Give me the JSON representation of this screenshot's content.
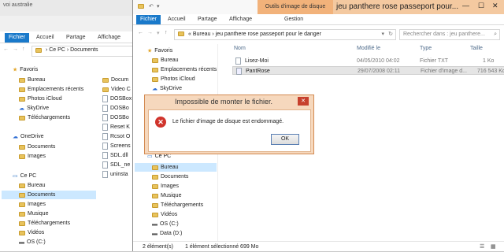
{
  "back_window": {
    "title": "voi australie",
    "tabs": [
      "Fichier",
      "Accueil",
      "Partage",
      "Affichage"
    ],
    "address": [
      "Ce PC",
      "Documents"
    ],
    "nav": {
      "favorites": "Favoris",
      "fav_items": [
        "Bureau",
        "Emplacements récents",
        "Photos iCloud",
        "SkyDrive",
        "Téléchargements"
      ],
      "onedrive": "OneDrive",
      "onedrive_items": [
        "Documents",
        "Images"
      ],
      "cepc": "Ce PC",
      "cepc_items": [
        "Bureau",
        "Documents",
        "Images",
        "Musique",
        "Téléchargements",
        "Vidéos",
        "OS (C:)"
      ]
    },
    "files": [
      "Docum",
      "Video C",
      "DOSBox",
      "DOSBo",
      "DOSBo",
      "Reset K",
      "Rcsot O",
      "Screens",
      "SDL.dll",
      "SDL_ne",
      "uninsta"
    ]
  },
  "front_window": {
    "tool_tab": "Outils d'image de disque",
    "title": "jeu panthere rose passeport pour...",
    "tabs": [
      "Fichier",
      "Accueil",
      "Partage",
      "Affichage"
    ],
    "gestion": "Gestion",
    "address": [
      "Bureau",
      "jeu panthere rose passeport pour le danger"
    ],
    "search_placeholder": "Rechercher dans : jeu panthere...",
    "columns": {
      "name": "Nom",
      "modified": "Modifié le",
      "type": "Type",
      "size": "Taille"
    },
    "files": [
      {
        "name": "Lisez-Moi",
        "modified": "04/05/2010 04:02",
        "type": "Fichier TXT",
        "size": "1 Ko"
      },
      {
        "name": "PantRose",
        "modified": "29/07/2008 02:11",
        "type": "Fichier d'image d...",
        "size": "716 543 Ko"
      }
    ],
    "nav": {
      "favorites": "Favoris",
      "fav_items": [
        "Bureau",
        "Emplacements récents",
        "Photos iCloud",
        "SkyDrive"
      ],
      "cepc": "Ce PC",
      "cepc_items": [
        "Bureau",
        "Documents",
        "Images",
        "Musique",
        "Téléchargements",
        "Vidéos",
        "OS (C:)",
        "Data (D:)"
      ]
    },
    "status": {
      "count": "2 élément(s)",
      "selected": "1 élément sélectionné  699 Mo"
    }
  },
  "dialog": {
    "title": "Impossible de monter le fichier.",
    "message": "Le fichier d'image de disque est endommagé.",
    "ok": "OK"
  },
  "colors": {
    "accent": "#1979ca",
    "dialog_border": "#d38a52",
    "error": "#d0342c"
  }
}
